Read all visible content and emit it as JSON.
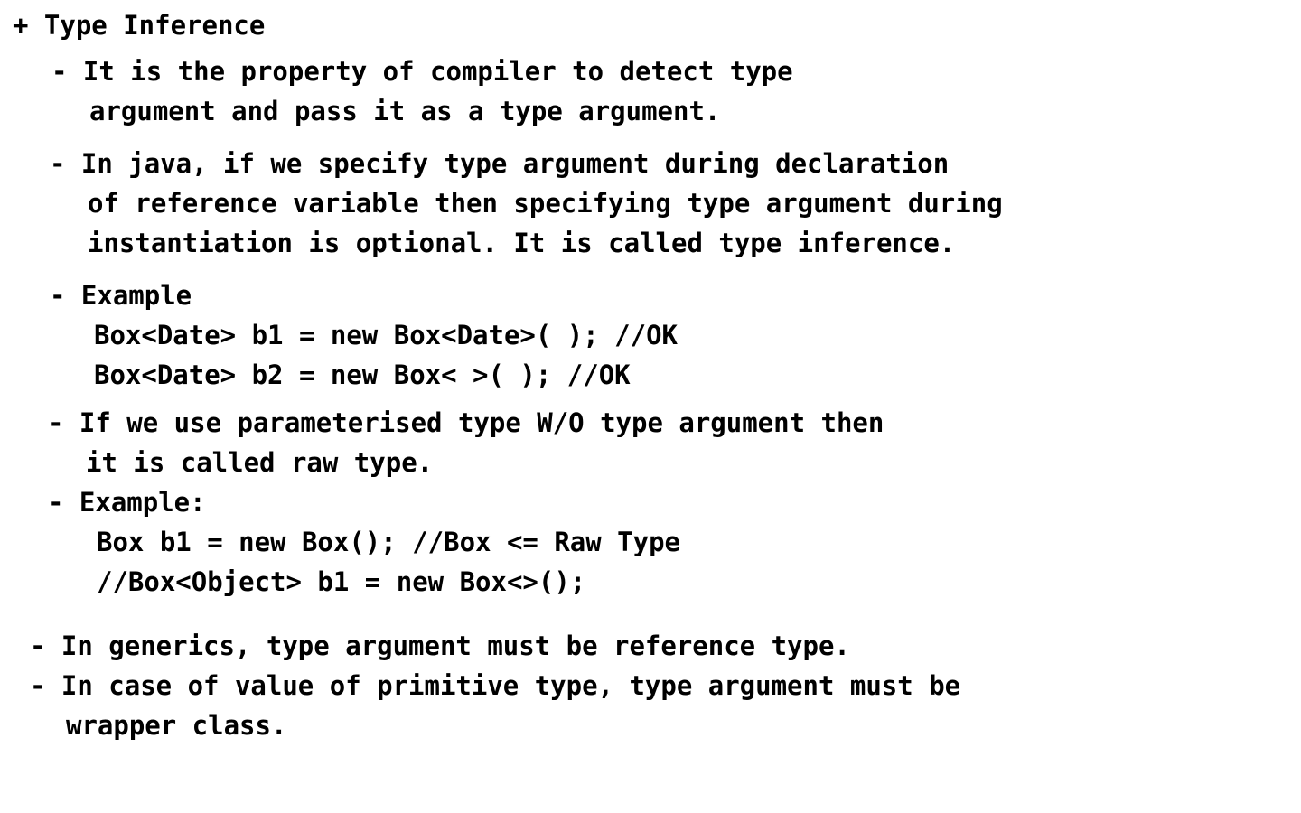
{
  "heading": "+ Type Inference",
  "bullets": {
    "b1": {
      "line1": "- It is the property of compiler to detect type",
      "line2": "argument and pass it as a type argument."
    },
    "b2": {
      "line1": "- In java, if we specify type argument during declaration",
      "line2": "of reference variable then specifying type argument during",
      "line3": "instantiation is optional. It is called type inference."
    },
    "b3": {
      "label": "- Example",
      "code1": "Box<Date> b1 = new Box<Date>( ); //OK",
      "code2": "Box<Date> b2 = new Box< >( ); //OK"
    },
    "b4": {
      "line1": "- If we use parameterised type W/O type argument then",
      "line2": "it is called raw type."
    },
    "b5": {
      "label": "- Example:",
      "code1": "Box b1 = new Box(); //Box <= Raw Type",
      "code2": "//Box<Object> b1 = new Box<>();"
    },
    "b6": {
      "line1": "- In generics, type argument must be reference type."
    },
    "b7": {
      "line1": "- In case of value of primitive type, type argument must be",
      "line2": "wrapper class."
    }
  }
}
